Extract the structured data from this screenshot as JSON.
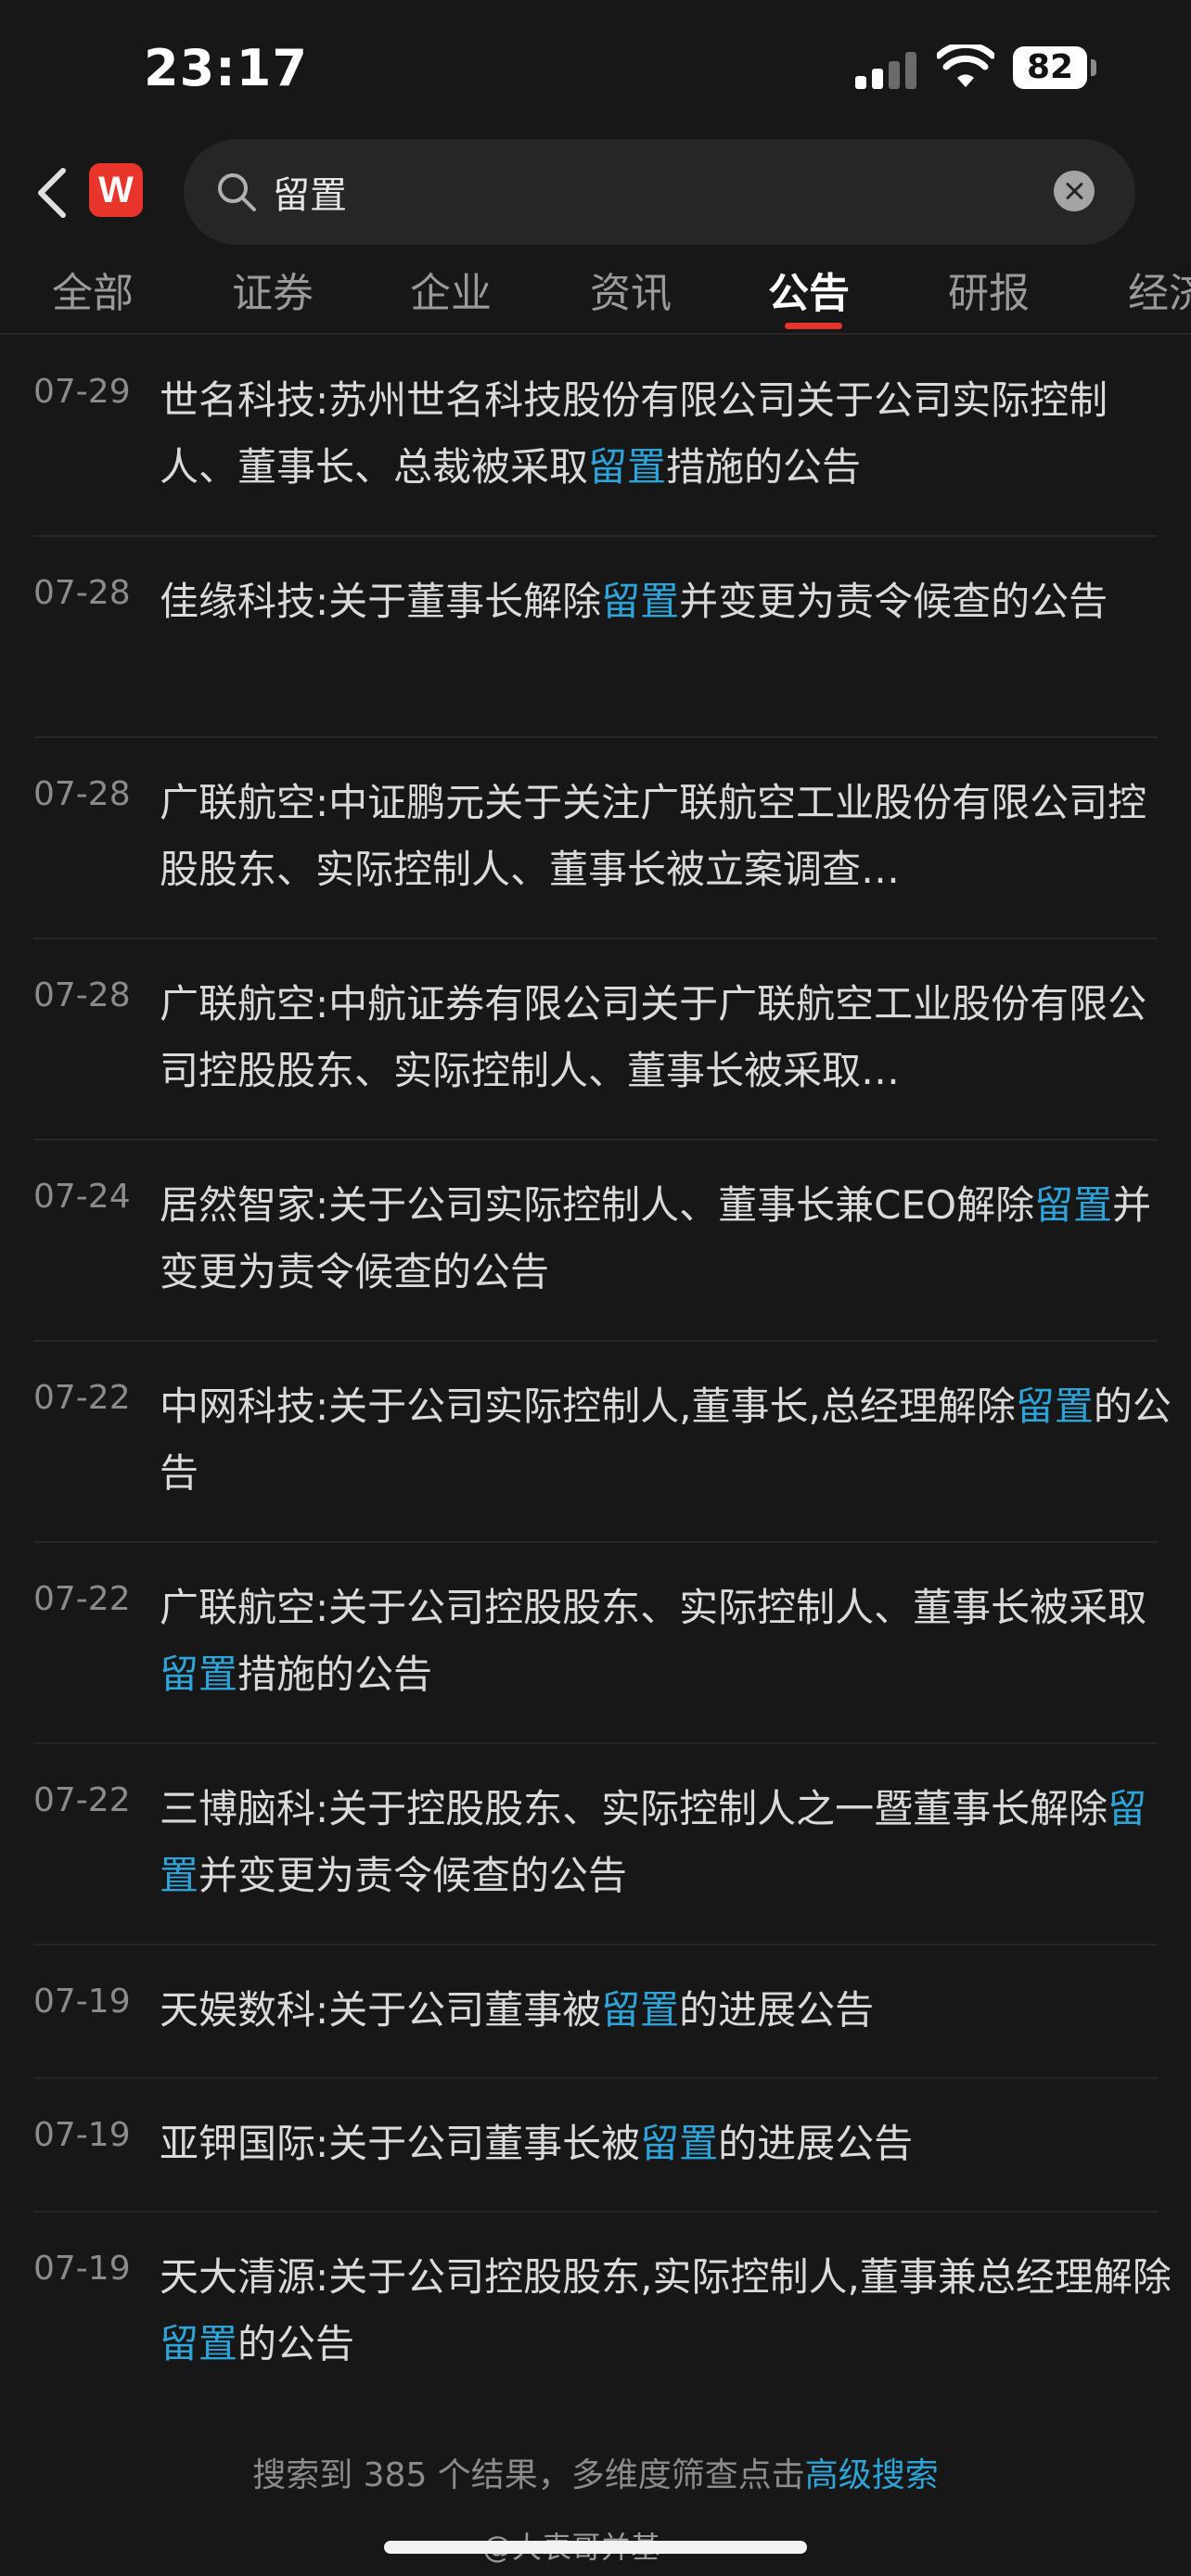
{
  "status": {
    "time": "23:17",
    "battery": "82"
  },
  "search": {
    "query": "留置"
  },
  "tabs": [
    {
      "label": "全部"
    },
    {
      "label": "证券"
    },
    {
      "label": "企业"
    },
    {
      "label": "资讯"
    },
    {
      "label": "公告"
    },
    {
      "label": "研报"
    },
    {
      "label": "经济"
    }
  ],
  "results": [
    {
      "date": "07-29",
      "pre": "世名科技:苏州世名科技股份有限公司关于公司实际控制人、董事长、总裁被采取",
      "hl": "留置",
      "post": "措施的公告"
    },
    {
      "date": "07-28",
      "pre": "佳缘科技:关于董事长解除",
      "hl": "留置",
      "post": "并变更为责令候查的公告"
    },
    {
      "date": "07-28",
      "pre": "广联航空:中证鹏元关于关注广联航空工业股份有限公司控股股东、实际控制人、董事长被立案调查…",
      "hl": "",
      "post": ""
    },
    {
      "date": "07-28",
      "pre": "广联航空:中航证券有限公司关于广联航空工业股份有限公司控股股东、实际控制人、董事长被采取…",
      "hl": "",
      "post": ""
    },
    {
      "date": "07-24",
      "pre": "居然智家:关于公司实际控制人、董事长兼CEO解除",
      "hl": "留置",
      "post": "并变更为责令候查的公告"
    },
    {
      "date": "07-22",
      "pre": "中网科技:关于公司实际控制人,董事长,总经理解除",
      "hl": "留置",
      "post": "的公告"
    },
    {
      "date": "07-22",
      "pre": "广联航空:关于公司控股股东、实际控制人、董事长被采取",
      "hl": "留置",
      "post": "措施的公告"
    },
    {
      "date": "07-22",
      "pre": "三博脑科:关于控股股东、实际控制人之一暨董事长解除",
      "hl": "留置",
      "post": "并变更为责令候查的公告"
    },
    {
      "date": "07-19",
      "pre": "天娱数科:关于公司董事被",
      "hl": "留置",
      "post": "的进展公告"
    },
    {
      "date": "07-19",
      "pre": "亚钾国际:关于公司董事长被",
      "hl": "留置",
      "post": "的进展公告"
    },
    {
      "date": "07-19",
      "pre": "天大清源:关于公司控股股东,实际控制人,董事兼总经理解除",
      "hl": "留置",
      "post": "的公告"
    }
  ],
  "footer": {
    "text": "搜索到 385 个结果，多维度筛查点击",
    "link": "高级搜索"
  },
  "watermark": "@大表哥并基",
  "colors": {
    "accent": "#e8352c",
    "highlight": "#2ea3d8",
    "background": "#171717"
  }
}
